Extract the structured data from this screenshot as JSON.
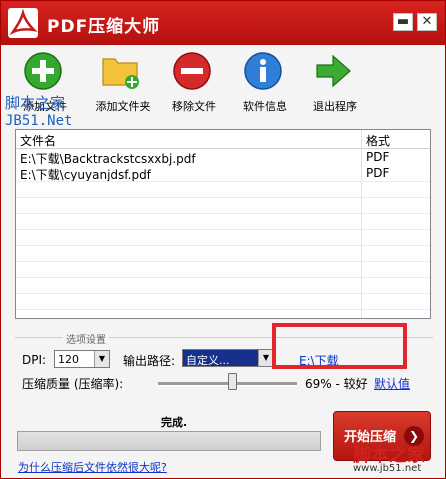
{
  "window": {
    "title": "PDF压缩大师",
    "minimize_glyph": "▬",
    "close_glyph": "✕"
  },
  "toolbar": [
    {
      "id": "add",
      "label": "添加文件",
      "icon": "add-file-icon"
    },
    {
      "id": "folder",
      "label": "添加文件夹",
      "icon": "add-folder-icon"
    },
    {
      "id": "remove",
      "label": "移除文件",
      "icon": "remove-file-icon"
    },
    {
      "id": "info",
      "label": "软件信息",
      "icon": "info-icon"
    },
    {
      "id": "exit",
      "label": "退出程序",
      "icon": "exit-arrow-icon"
    }
  ],
  "file_list": {
    "columns": [
      "文件名",
      "格式"
    ],
    "rows": [
      {
        "name": "E:\\下载\\Backtrackstcsxxbj.pdf",
        "format": "PDF"
      },
      {
        "name": "E:\\下载\\cyuyanjdsf.pdf",
        "format": "PDF"
      }
    ]
  },
  "watermark": {
    "cn": "脚本之家",
    "en": "JB51.Net"
  },
  "options": {
    "group_title": "选项设置",
    "dpi_label": "DPI:",
    "dpi_value": "120",
    "output_label": "输出路径:",
    "output_mode": "自定义...",
    "output_path": "E:\\下载",
    "quality_label": "压缩质量 (压缩率):",
    "quality_text": "69% - 较好",
    "quality_fraction": 0.69,
    "default_label": "默认值"
  },
  "status": {
    "text": "完成.",
    "progress_fraction": 0,
    "start_button": "开始压缩",
    "help_link": "为什么压缩后文件依然很大呢?"
  },
  "corner_watermark": {
    "cn": "脚本之家",
    "url": "www.jb51.net"
  },
  "colors": {
    "title_red": "#c8191a",
    "link_blue": "#0b31c9",
    "highlight_box": "#e3262c"
  }
}
